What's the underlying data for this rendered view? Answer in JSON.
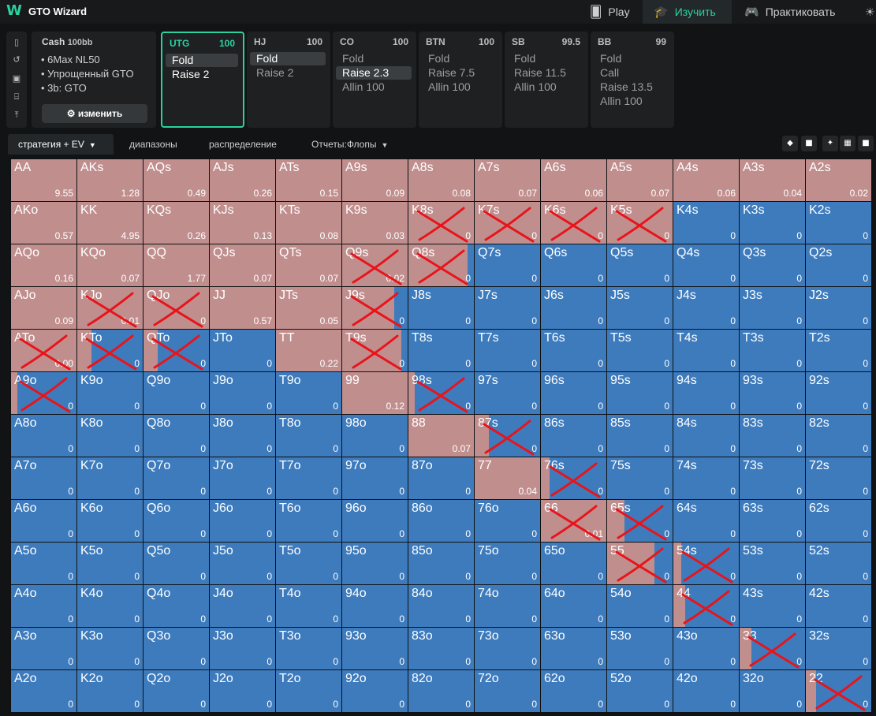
{
  "app": {
    "title": "GTO Wizard",
    "logo": "W"
  },
  "nav": [
    {
      "label": "Play",
      "icon": "cards-icon"
    },
    {
      "label": "Изучить",
      "icon": "graduation-cap-icon"
    },
    {
      "label": "Практиковать",
      "icon": "gamepad-icon"
    },
    {
      "label": "",
      "icon": "lightbulb-icon"
    }
  ],
  "sidebar_icons": [
    "bookmark-icon",
    "history-icon",
    "save-icon",
    "gamepad-icon",
    "align-icon"
  ],
  "info": {
    "game": "Cash",
    "stack": "100bb",
    "lines": [
      "6Max NL50",
      "Упрощенный GTO",
      "3b: GTO"
    ],
    "edit_label": "изменить"
  },
  "positions": [
    {
      "name": "UTG",
      "stack": "100",
      "active": true,
      "actions": [
        "Fold",
        "Raise 2"
      ],
      "selected": 0
    },
    {
      "name": "HJ",
      "stack": "100",
      "active": false,
      "actions": [
        "Fold",
        "Raise 2"
      ],
      "selected": 0
    },
    {
      "name": "CO",
      "stack": "100",
      "active": false,
      "actions": [
        "Fold",
        "Raise 2.3",
        "Allin 100"
      ],
      "selected": 1
    },
    {
      "name": "BTN",
      "stack": "100",
      "active": false,
      "actions": [
        "Fold",
        "Raise 7.5",
        "Allin 100"
      ],
      "selected": -1
    },
    {
      "name": "SB",
      "stack": "99.5",
      "active": false,
      "actions": [
        "Fold",
        "Raise 11.5",
        "Allin 100"
      ],
      "selected": -1
    },
    {
      "name": "BB",
      "stack": "99",
      "active": false,
      "actions": [
        "Fold",
        "Call",
        "Raise 13.5",
        "Allin 100"
      ],
      "selected": -1
    }
  ],
  "tabs": [
    "стратегия + EV",
    "диапазоны",
    "распределение",
    "Отчеты:Флопы"
  ],
  "view_buttons": [
    "3d-icon",
    "square-icon",
    "compress-icon",
    "grid-icon",
    "fullscreen-icon"
  ],
  "colors": {
    "raise": "#c18e8e",
    "fold": "#3d7bbd",
    "accent": "#2bd1a0",
    "marker": "#e8141a"
  },
  "matrix": {
    "rows": [
      [
        "AA",
        "AKs",
        "AQs",
        "AJs",
        "ATs",
        "A9s",
        "A8s",
        "A7s",
        "A6s",
        "A5s",
        "A4s",
        "A3s",
        "A2s"
      ],
      [
        "AKo",
        "KK",
        "KQs",
        "KJs",
        "KTs",
        "K9s",
        "K8s",
        "K7s",
        "K6s",
        "K5s",
        "K4s",
        "K3s",
        "K2s"
      ],
      [
        "AQo",
        "KQo",
        "QQ",
        "QJs",
        "QTs",
        "Q9s",
        "Q8s",
        "Q7s",
        "Q6s",
        "Q5s",
        "Q4s",
        "Q3s",
        "Q2s"
      ],
      [
        "AJo",
        "KJo",
        "QJo",
        "JJ",
        "JTs",
        "J9s",
        "J8s",
        "J7s",
        "J6s",
        "J5s",
        "J4s",
        "J3s",
        "J2s"
      ],
      [
        "ATo",
        "KTo",
        "QTo",
        "JTo",
        "TT",
        "T9s",
        "T8s",
        "T7s",
        "T6s",
        "T5s",
        "T4s",
        "T3s",
        "T2s"
      ],
      [
        "A9o",
        "K9o",
        "Q9o",
        "J9o",
        "T9o",
        "99",
        "98s",
        "97s",
        "96s",
        "95s",
        "94s",
        "93s",
        "92s"
      ],
      [
        "A8o",
        "K8o",
        "Q8o",
        "J8o",
        "T8o",
        "98o",
        "88",
        "87s",
        "86s",
        "85s",
        "84s",
        "83s",
        "82s"
      ],
      [
        "A7o",
        "K7o",
        "Q7o",
        "J7o",
        "T7o",
        "97o",
        "87o",
        "77",
        "76s",
        "75s",
        "74s",
        "73s",
        "72s"
      ],
      [
        "A6o",
        "K6o",
        "Q6o",
        "J6o",
        "T6o",
        "96o",
        "86o",
        "76o",
        "66",
        "65s",
        "64s",
        "63s",
        "62s"
      ],
      [
        "A5o",
        "K5o",
        "Q5o",
        "J5o",
        "T5o",
        "95o",
        "85o",
        "75o",
        "65o",
        "55",
        "54s",
        "53s",
        "52s"
      ],
      [
        "A4o",
        "K4o",
        "Q4o",
        "J4o",
        "T4o",
        "94o",
        "84o",
        "74o",
        "64o",
        "54o",
        "44",
        "43s",
        "42s"
      ],
      [
        "A3o",
        "K3o",
        "Q3o",
        "J3o",
        "T3o",
        "93o",
        "83o",
        "73o",
        "63o",
        "53o",
        "43o",
        "33",
        "32s"
      ],
      [
        "A2o",
        "K2o",
        "Q2o",
        "J2o",
        "T2o",
        "92o",
        "82o",
        "72o",
        "62o",
        "52o",
        "42o",
        "32o",
        "22"
      ]
    ],
    "ev": [
      [
        "9.55",
        "1.28",
        "0.49",
        "0.26",
        "0.15",
        "0.09",
        "0.08",
        "0.07",
        "0.06",
        "0.07",
        "0.06",
        "0.04",
        "0.02"
      ],
      [
        "0.57",
        "4.95",
        "0.26",
        "0.13",
        "0.08",
        "0.03",
        "0",
        "0",
        "0",
        "0",
        "0",
        "0",
        "0"
      ],
      [
        "0.16",
        "0.07",
        "1.77",
        "0.07",
        "0.07",
        "0.02",
        "0",
        "0",
        "0",
        "0",
        "0",
        "0",
        "0"
      ],
      [
        "0.09",
        "0.01",
        "0",
        "0.57",
        "0.05",
        "0",
        "0",
        "0",
        "0",
        "0",
        "0",
        "0",
        "0"
      ],
      [
        "0.00",
        "0",
        "0",
        "0",
        "0.22",
        "0",
        "0",
        "0",
        "0",
        "0",
        "0",
        "0",
        "0"
      ],
      [
        "0",
        "0",
        "0",
        "0",
        "0",
        "0.12",
        "0",
        "0",
        "0",
        "0",
        "0",
        "0",
        "0"
      ],
      [
        "0",
        "0",
        "0",
        "0",
        "0",
        "0",
        "0.07",
        "0",
        "0",
        "0",
        "0",
        "0",
        "0"
      ],
      [
        "0",
        "0",
        "0",
        "0",
        "0",
        "0",
        "0",
        "0.04",
        "0",
        "0",
        "0",
        "0",
        "0"
      ],
      [
        "0",
        "0",
        "0",
        "0",
        "0",
        "0",
        "0",
        "0",
        "0.01",
        "0",
        "0",
        "0",
        "0"
      ],
      [
        "0",
        "0",
        "0",
        "0",
        "0",
        "0",
        "0",
        "0",
        "0",
        "0",
        "0",
        "0",
        "0"
      ],
      [
        "0",
        "0",
        "0",
        "0",
        "0",
        "0",
        "0",
        "0",
        "0",
        "0",
        "0",
        "0",
        "0"
      ],
      [
        "0",
        "0",
        "0",
        "0",
        "0",
        "0",
        "0",
        "0",
        "0",
        "0",
        "0",
        "0",
        "0"
      ],
      [
        "0",
        "0",
        "0",
        "0",
        "0",
        "0",
        "0",
        "0",
        "0",
        "0",
        "0",
        "0",
        "0"
      ]
    ],
    "raise_frequency": [
      [
        1,
        1,
        1,
        1,
        1,
        1,
        1,
        1,
        1,
        1,
        1,
        1,
        1
      ],
      [
        1,
        1,
        1,
        1,
        1,
        1,
        1,
        1,
        1,
        1,
        0,
        0,
        0
      ],
      [
        1,
        1,
        1,
        1,
        1,
        1,
        0.9,
        0,
        0,
        0,
        0,
        0,
        0
      ],
      [
        1,
        1,
        1,
        1,
        1,
        0.8,
        0,
        0,
        0,
        0,
        0,
        0,
        0
      ],
      [
        1,
        0.22,
        0.22,
        0,
        1,
        0.9,
        0,
        0,
        0,
        0,
        0,
        0,
        0
      ],
      [
        0.1,
        0,
        0,
        0,
        0,
        1,
        0.1,
        0,
        0,
        0,
        0,
        0,
        0
      ],
      [
        0,
        0,
        0,
        0,
        0,
        0,
        1,
        0.22,
        0,
        0,
        0,
        0,
        0
      ],
      [
        0,
        0,
        0,
        0,
        0,
        0,
        0,
        1,
        0.13,
        0,
        0,
        0,
        0
      ],
      [
        0,
        0,
        0,
        0,
        0,
        0,
        0,
        0,
        1,
        0.26,
        0,
        0,
        0
      ],
      [
        0,
        0,
        0,
        0,
        0,
        0,
        0,
        0,
        0,
        0.72,
        0.12,
        0,
        0
      ],
      [
        0,
        0,
        0,
        0,
        0,
        0,
        0,
        0,
        0,
        0,
        0.18,
        0,
        0
      ],
      [
        0,
        0,
        0,
        0,
        0,
        0,
        0,
        0,
        0,
        0,
        0,
        0.18,
        0
      ],
      [
        0,
        0,
        0,
        0,
        0,
        0,
        0,
        0,
        0,
        0,
        0,
        0,
        0.16
      ]
    ],
    "crossed": [
      [
        1,
        6
      ],
      [
        1,
        7
      ],
      [
        1,
        8
      ],
      [
        1,
        9
      ],
      [
        2,
        5
      ],
      [
        2,
        6
      ],
      [
        3,
        1
      ],
      [
        3,
        2
      ],
      [
        3,
        5
      ],
      [
        4,
        0
      ],
      [
        4,
        1
      ],
      [
        4,
        2
      ],
      [
        4,
        5
      ],
      [
        5,
        0
      ],
      [
        5,
        6
      ],
      [
        6,
        7
      ],
      [
        7,
        8
      ],
      [
        8,
        8
      ],
      [
        8,
        9
      ],
      [
        9,
        9
      ],
      [
        9,
        10
      ],
      [
        10,
        10
      ],
      [
        11,
        11
      ],
      [
        12,
        12
      ]
    ]
  }
}
